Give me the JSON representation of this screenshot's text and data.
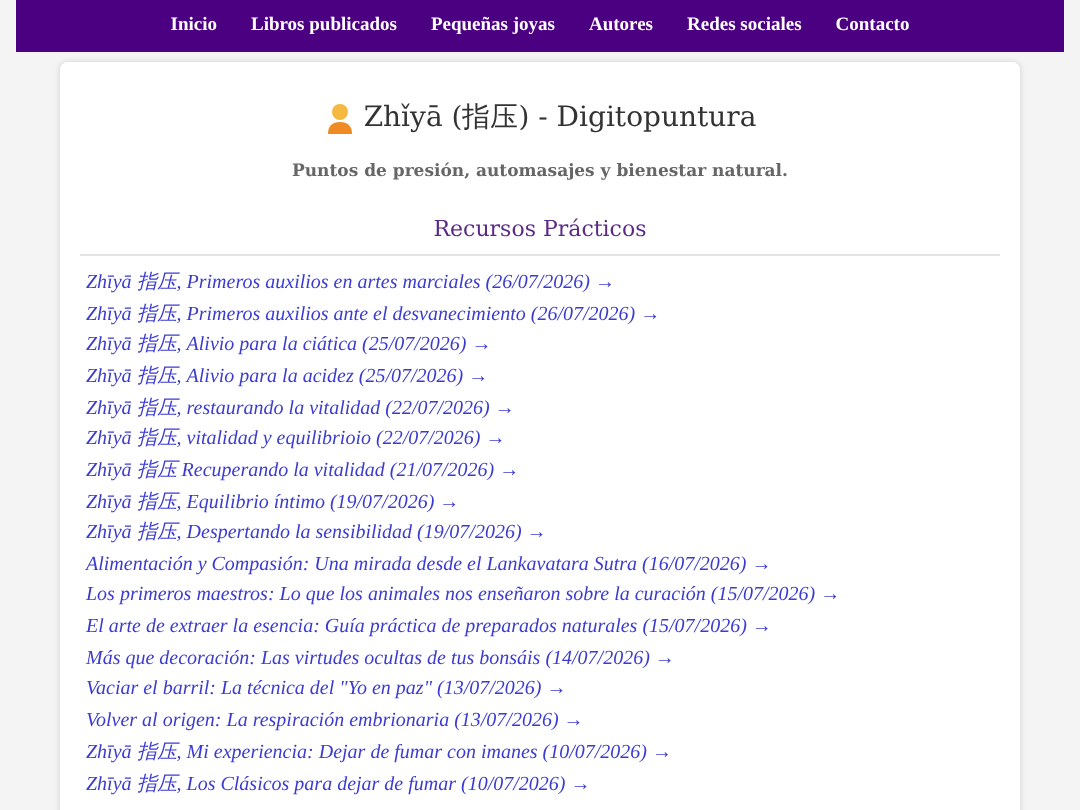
{
  "nav": [
    {
      "label": "Inicio"
    },
    {
      "label": "Libros publicados"
    },
    {
      "label": "Pequeñas joyas"
    },
    {
      "label": "Autores"
    },
    {
      "label": "Redes sociales"
    },
    {
      "label": "Contacto"
    }
  ],
  "title": "Zhǐyā (指压) - Digitopuntura",
  "subtitle": "Puntos de presión, automasajes y bienestar natural.",
  "section": {
    "heading": "Recursos Prácticos",
    "links": [
      "Zhīyā 指压, Primeros auxilios en artes marciales (26/07/2026) →",
      "Zhīyā 指压, Primeros auxilios ante el desvanecimiento (26/07/2026) →",
      "Zhīyā 指压, Alivio para la ciática (25/07/2026) →",
      "Zhīyā 指压, Alivio para la acidez (25/07/2026) →",
      "Zhīyā 指压, restaurando la vitalidad (22/07/2026) →",
      "Zhīyā 指压, vitalidad y equilibrioio (22/07/2026) →",
      "Zhīyā 指压 Recuperando la vitalidad (21/07/2026) →",
      "Zhīyā 指压, Equilibrio íntimo (19/07/2026) →",
      "Zhīyā 指压, Despertando la sensibilidad (19/07/2026) →",
      "Alimentación y Compasión: Una mirada desde el Lankavatara Sutra (16/07/2026) →",
      "Los primeros maestros: Lo que los animales nos enseñaron sobre la curación (15/07/2026) →",
      "El arte de extraer la esencia: Guía práctica de preparados naturales (15/07/2026) →",
      "Más que decoración: Las virtudes ocultas de tus bonsáis (14/07/2026) →",
      "Vaciar el barril: La técnica del \"Yo en paz\" (13/07/2026) →",
      "Volver al origen: La respiración embrionaria (13/07/2026) →",
      "Zhīyā 指压, Mi experiencia: Dejar de fumar con imanes (10/07/2026) →",
      "Zhīyā 指压, Los Clásicos para dejar de fumar (10/07/2026) →"
    ]
  }
}
